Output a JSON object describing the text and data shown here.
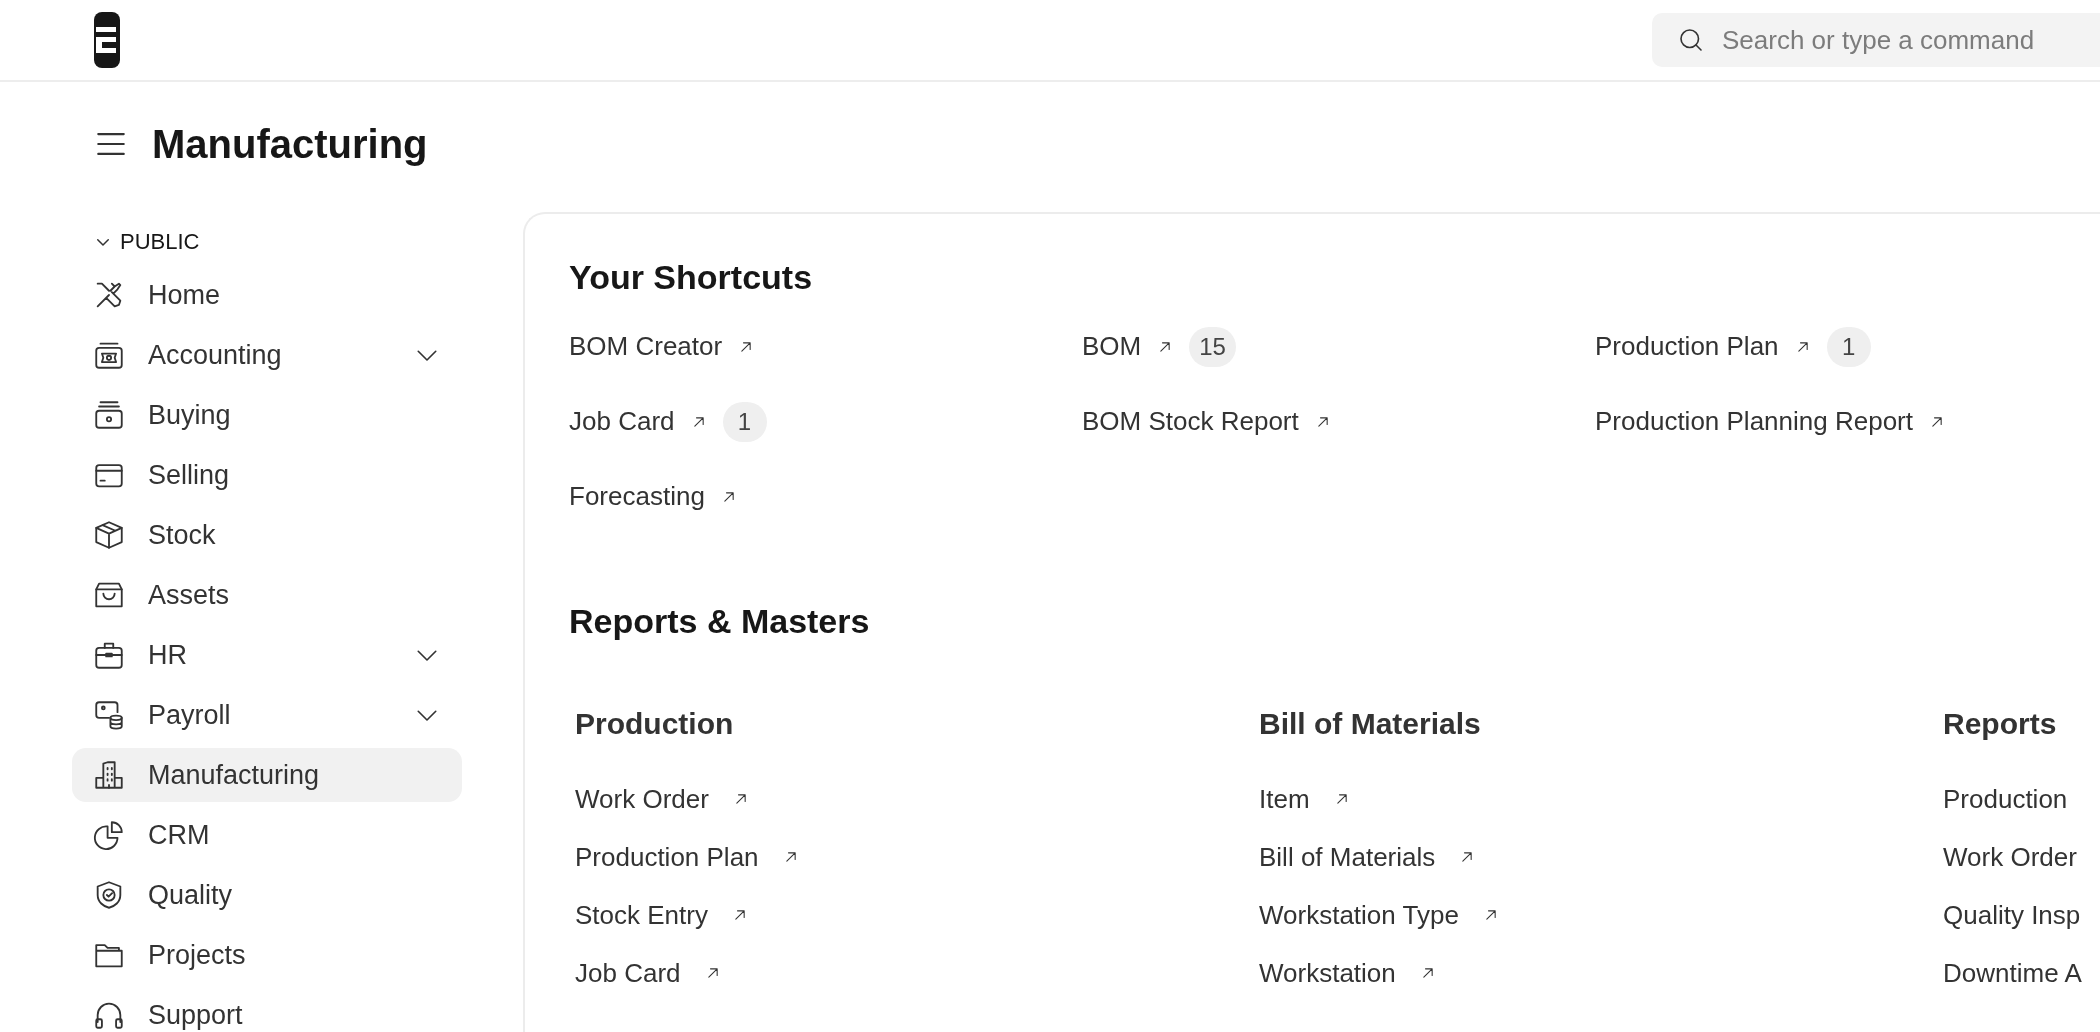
{
  "header": {
    "search": {
      "placeholder": "Search or type a command"
    }
  },
  "page": {
    "title": "Manufacturing"
  },
  "sidebar": {
    "section": {
      "label": "PUBLIC",
      "expanded": true
    },
    "items": [
      {
        "label": "Home",
        "kind": "link",
        "selected": false
      },
      {
        "label": "Accounting",
        "kind": "group",
        "selected": false
      },
      {
        "label": "Buying",
        "kind": "link",
        "selected": false
      },
      {
        "label": "Selling",
        "kind": "link",
        "selected": false
      },
      {
        "label": "Stock",
        "kind": "link",
        "selected": false
      },
      {
        "label": "Assets",
        "kind": "link",
        "selected": false
      },
      {
        "label": "HR",
        "kind": "group",
        "selected": false
      },
      {
        "label": "Payroll",
        "kind": "group",
        "selected": false
      },
      {
        "label": "Manufacturing",
        "kind": "link",
        "selected": true
      },
      {
        "label": "CRM",
        "kind": "link",
        "selected": false
      },
      {
        "label": "Quality",
        "kind": "link",
        "selected": false
      },
      {
        "label": "Projects",
        "kind": "link",
        "selected": false
      },
      {
        "label": "Support",
        "kind": "link",
        "selected": false
      }
    ]
  },
  "shortcuts": {
    "title": "Your Shortcuts",
    "items": [
      {
        "label": "BOM Creator"
      },
      {
        "label": "BOM",
        "count": "15"
      },
      {
        "label": "Production Plan",
        "count": "1"
      },
      {
        "label": "Job Card",
        "count": "1"
      },
      {
        "label": "BOM Stock Report"
      },
      {
        "label": "Production Planning Report"
      },
      {
        "label": "Forecasting"
      }
    ]
  },
  "reports": {
    "title": "Reports & Masters",
    "columns": [
      {
        "title": "Production",
        "links": [
          {
            "label": "Work Order",
            "arrow": true
          },
          {
            "label": "Production Plan",
            "arrow": true
          },
          {
            "label": "Stock Entry",
            "arrow": true
          },
          {
            "label": "Job Card",
            "arrow": true
          }
        ]
      },
      {
        "title": "Bill of Materials",
        "links": [
          {
            "label": "Item",
            "arrow": true
          },
          {
            "label": "Bill of Materials",
            "arrow": true
          },
          {
            "label": "Workstation Type",
            "arrow": true
          },
          {
            "label": "Workstation",
            "arrow": true
          }
        ]
      },
      {
        "title": "Reports",
        "links": [
          {
            "label": "Production",
            "arrow": false
          },
          {
            "label": "Work Order",
            "arrow": false
          },
          {
            "label": "Quality Insp",
            "arrow": false
          },
          {
            "label": "Downtime A",
            "arrow": false
          }
        ]
      }
    ]
  }
}
